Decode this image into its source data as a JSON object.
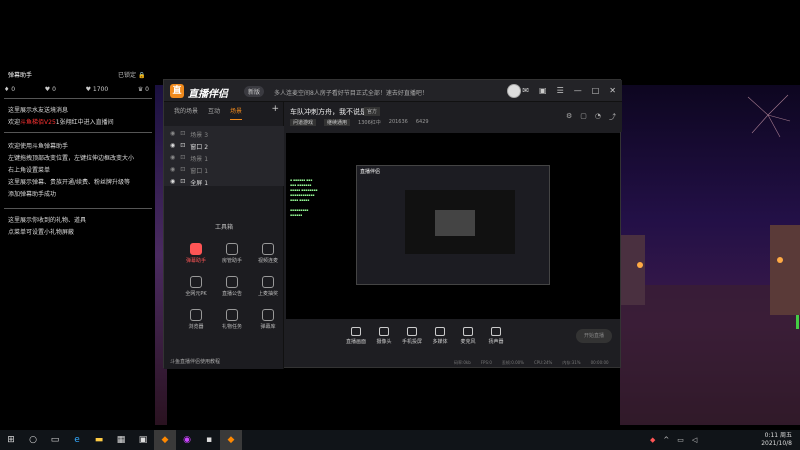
{
  "helper": {
    "title": "弹幕助手",
    "lock_label": "已锁定",
    "stats": [
      "0",
      "0",
      "1700",
      "0"
    ],
    "messages": [
      {
        "text_a": "这里展示水友送境消息",
        "red": "",
        "text_b": ""
      },
      {
        "text_a": "欢迎",
        "red": "斗鱼梯佰V25",
        "text_b": "1张翔红中进入直播间"
      },
      {
        "text_a": "欢迎使用斗鱼弹幕助手",
        "red": "",
        "text_b": ""
      },
      {
        "text_a": "左键拖拽顶部改变位置，左键拉伸边框改变大小",
        "red": "",
        "text_b": ""
      },
      {
        "text_a": "右上角设置菜单",
        "red": "",
        "text_b": ""
      },
      {
        "text_a": "这里展示弹幕、贵族开通/续费、粉丝牌升级等",
        "red": "",
        "text_b": ""
      },
      {
        "text_a": "添加弹幕助手成功",
        "red": "",
        "text_b": ""
      },
      {
        "text_a": "这里展示你收到的礼物、道具",
        "red": "",
        "text_b": ""
      },
      {
        "text_a": "点菜单可设置小礼物屏蔽",
        "red": "",
        "text_b": ""
      }
    ]
  },
  "app": {
    "title": "直播伴侣",
    "version": "新版",
    "notice": "多人连麦空间8人房子看好节目正式全部！速去好直播吧！",
    "tabs": [
      "我的场景",
      "互动",
      "场景"
    ],
    "scenes": [
      "场景 3",
      "窗口 2",
      "场景 1",
      "窗口 1",
      "全屏 1"
    ],
    "tools_header": "工具箱",
    "tools": [
      {
        "label": "弹幕助手",
        "active": true
      },
      {
        "label": "房管助手",
        "active": false
      },
      {
        "label": "视频连麦",
        "active": false
      },
      {
        "label": "全网元PK",
        "active": false
      },
      {
        "label": "直播公告",
        "active": false
      },
      {
        "label": "上麦抽奖",
        "active": false
      },
      {
        "label": "浏览器",
        "active": false
      },
      {
        "label": "礼物任务",
        "active": false
      },
      {
        "label": "弹幕库",
        "active": false
      }
    ],
    "footer_tip": "斗鱼直播伴侣使用教程",
    "room_title": "车队冲刺方舟，我不说是播",
    "room_tag": "官方",
    "category": "问道游戏",
    "category2": "继续通用",
    "meta1": "1306红中",
    "meta2": "201636",
    "meta3": "6429",
    "controls": [
      "直播画面",
      "摄像头",
      "手机投屏",
      "多媒体",
      "麦克风",
      "扬声器"
    ],
    "start_label": "开始直播",
    "status": [
      "码率:0kb",
      "FPS:0",
      "丢帧:0.00%",
      "CPU:24%",
      "内存:31%",
      "00:00:00"
    ]
  },
  "taskbar": {
    "time": "0:11 周五",
    "date": "2021/10/8"
  }
}
